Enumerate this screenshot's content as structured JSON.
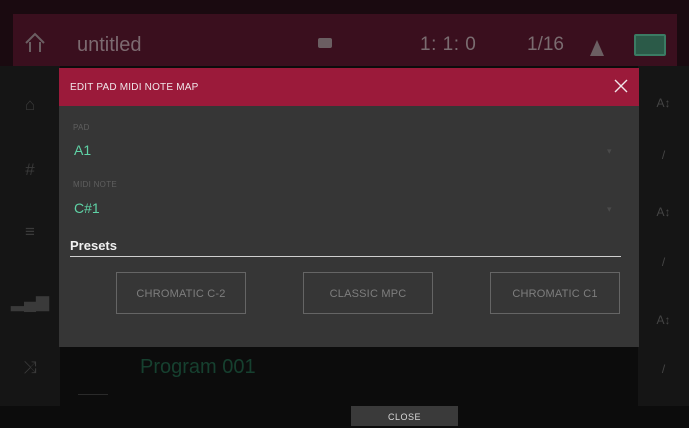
{
  "header": {
    "project_title": "untitled",
    "position": "1:   1:   0",
    "grid": "1/16"
  },
  "side_left": {
    "icons": [
      "home-icon",
      "grid-icon",
      "list-icon",
      "bars-icon",
      "shuffle-icon"
    ]
  },
  "side_right": {
    "icons": [
      "a-z-icon",
      "pencil-icon",
      "a-z-icon",
      "pencil-icon",
      "a-z-icon",
      "pencil-icon"
    ]
  },
  "program": {
    "name": "Program 001"
  },
  "modal": {
    "title": "EDIT PAD MIDI NOTE MAP",
    "pad_label": "PAD",
    "pad_value": "A1",
    "midi_label": "MIDI NOTE",
    "midi_value": "C#1",
    "presets_title": "Presets",
    "presets": [
      "CHROMATIC C-2",
      "CLASSIC MPC",
      "CHROMATIC C1"
    ]
  },
  "footer": {
    "close_label": "CLOSE"
  },
  "colors": {
    "accent": "#9b1a3a",
    "value": "#5fd3a6",
    "panel": "#363636"
  }
}
